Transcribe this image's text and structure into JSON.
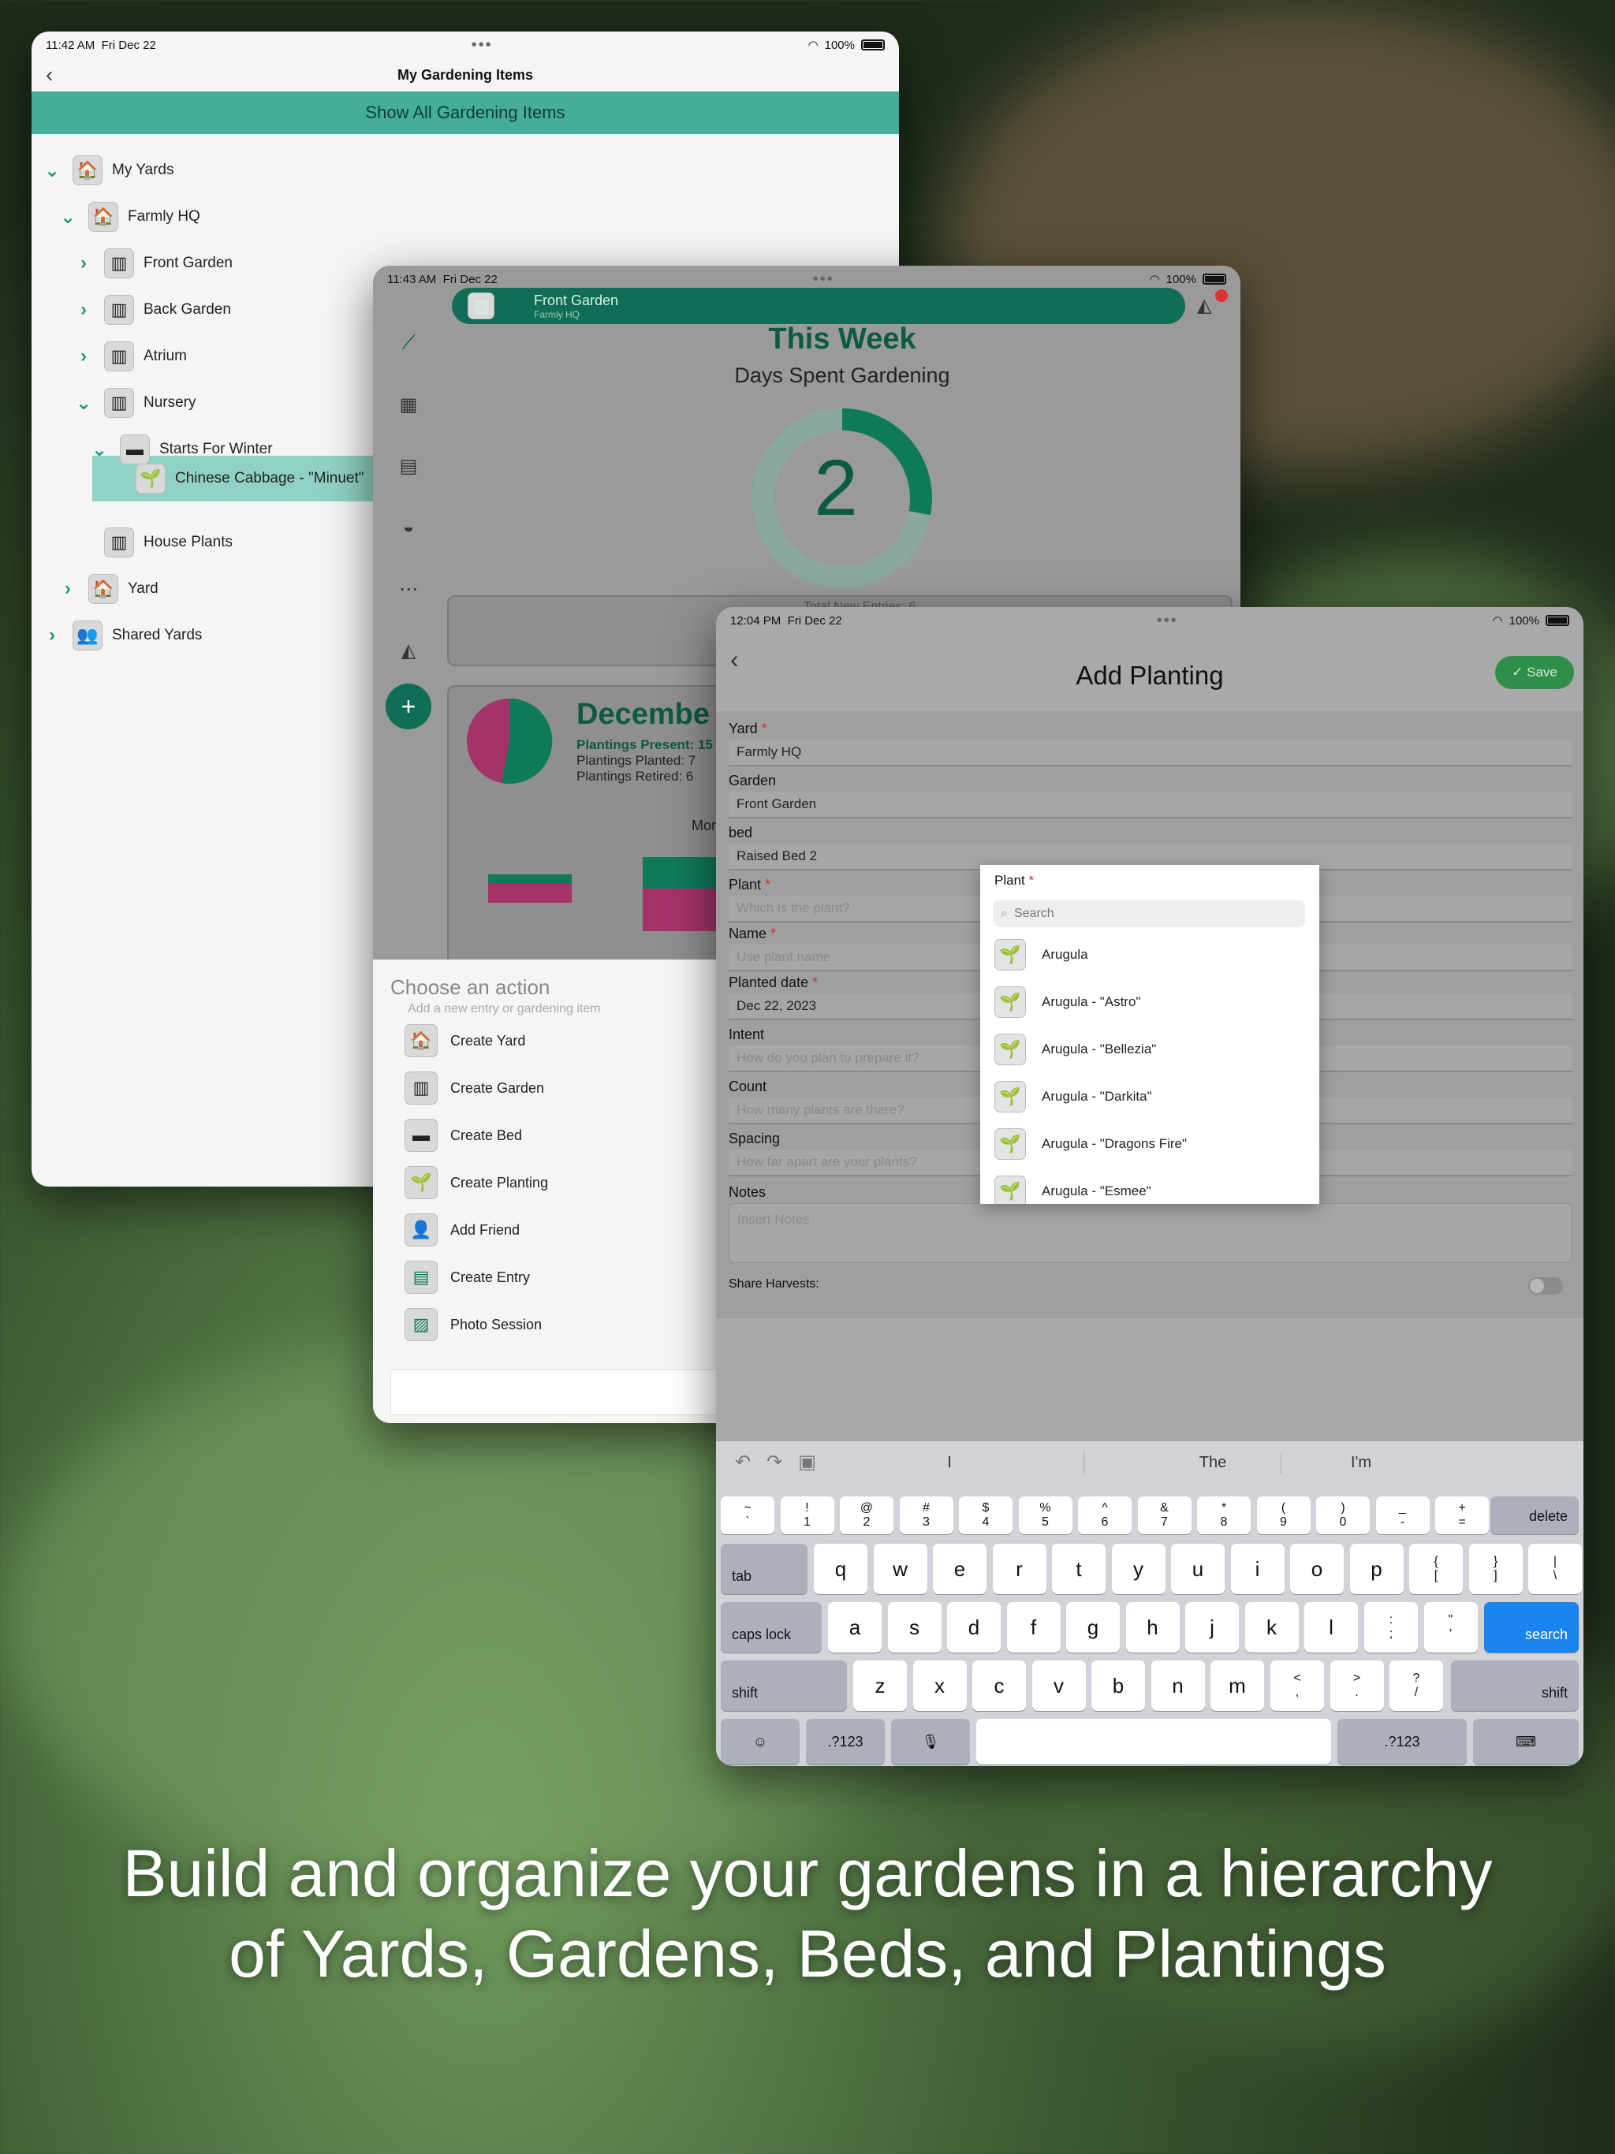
{
  "caption": "Build and organize your gardens in a hierarchy of Yards, Gardens, Beds, and Plantings",
  "tree_window": {
    "status": {
      "time": "11:42 AM",
      "date": "Fri Dec 22",
      "battery": "100%"
    },
    "title": "My Gardening Items",
    "show_all_label": "Show All Gardening Items",
    "items": [
      {
        "label": "My Yards",
        "chevron": "down",
        "icon": "house"
      },
      {
        "label": "Farmly HQ",
        "chevron": "down",
        "icon": "house"
      },
      {
        "label": "Front Garden",
        "chevron": "right",
        "icon": "garden"
      },
      {
        "label": "Back Garden",
        "chevron": "right",
        "icon": "garden"
      },
      {
        "label": "Atrium",
        "chevron": "right",
        "icon": "garden"
      },
      {
        "label": "Nursery",
        "chevron": "down",
        "icon": "garden"
      },
      {
        "label": "Starts For Winter",
        "chevron": "down",
        "icon": "bed"
      },
      {
        "label": "Chinese Cabbage - \"Minuet\"",
        "chevron": "",
        "icon": "planting"
      },
      {
        "label": "House Plants",
        "chevron": "",
        "icon": "garden"
      },
      {
        "label": "Yard",
        "chevron": "right",
        "icon": "house"
      },
      {
        "label": "Shared Yards",
        "chevron": "right",
        "icon": "people"
      }
    ]
  },
  "dashboard_window": {
    "status": {
      "time": "11:43 AM",
      "date": "Fri Dec 22",
      "battery": "100%"
    },
    "garden_name": "Front Garden",
    "garden_yard": "Farmly HQ",
    "this_week": "This Week",
    "days_spent_label": "Days Spent Gardening",
    "days_spent_value": "2",
    "days_spent_fraction": 0.28,
    "month_title": "Decembe",
    "plantings_present": "Plantings Present: 15",
    "plantings_planted": "Plantings Planted: 7",
    "plantings_retired": "Plantings Retired: 6",
    "more_label": "Mor",
    "total_text": "Total New Entries: 6",
    "action_sheet": {
      "title": "Choose an action",
      "subtitle": "Add a new entry or gardening item",
      "actions": [
        {
          "label": "Create Yard",
          "icon": "house"
        },
        {
          "label": "Create Garden",
          "icon": "garden"
        },
        {
          "label": "Create Bed",
          "icon": "bed"
        },
        {
          "label": "Create Planting",
          "icon": "planting"
        },
        {
          "label": "Add Friend",
          "icon": "friend"
        },
        {
          "label": "Create Entry",
          "icon": "entry"
        },
        {
          "label": "Photo Session",
          "icon": "photo"
        }
      ]
    }
  },
  "add_window": {
    "status": {
      "time": "12:04 PM",
      "date": "Fri Dec 22",
      "battery": "100%"
    },
    "save_label": "✓ Save",
    "title": "Add Planting",
    "fields": {
      "yard_label": "Yard",
      "yard_value": "Farmly HQ",
      "garden_label": "Garden",
      "garden_value": "Front Garden",
      "bed_label": "bed",
      "bed_value": "Raised Bed 2",
      "plant_label": "Plant",
      "plant_placeholder": "Which is the plant?",
      "name_label": "Name",
      "name_placeholder": "Use plant name",
      "date_label": "Planted date",
      "date_value": "Dec 22, 2023",
      "intent_label": "Intent",
      "intent_placeholder": "How do you plan to prepare it?",
      "count_label": "Count",
      "count_placeholder": "How many plants are there?",
      "spacing_label": "Spacing",
      "spacing_placeholder": "How far apart are your plants?",
      "notes_label": "Notes",
      "notes_placeholder": "Insert Notes",
      "share_label": "Share Harvests:"
    },
    "picker": {
      "title": "Plant",
      "search_placeholder": "Search",
      "options": [
        "Arugula",
        "Arugula - \"Astro\"",
        "Arugula - \"Bellezia\"",
        "Arugula - \"Darkita\"",
        "Arugula - \"Dragons Fire\"",
        "Arugula - \"Esmee\""
      ]
    },
    "keyboard": {
      "suggestions": [
        "I",
        "The",
        "I'm"
      ],
      "number_row": [
        [
          "~",
          "`"
        ],
        [
          "!",
          "1"
        ],
        [
          "@",
          "2"
        ],
        [
          "#",
          "3"
        ],
        [
          "$",
          "4"
        ],
        [
          "%",
          "5"
        ],
        [
          "^",
          "6"
        ],
        [
          "&",
          "7"
        ],
        [
          "*",
          "8"
        ],
        [
          "(",
          "9"
        ],
        [
          ")",
          "0"
        ],
        [
          "_",
          "-"
        ],
        [
          "+",
          "="
        ]
      ],
      "delete": "delete",
      "tab": "tab",
      "row1": [
        "q",
        "w",
        "e",
        "r",
        "t",
        "y",
        "u",
        "i",
        "o",
        "p"
      ],
      "row1_extra": [
        [
          "{",
          "["
        ],
        [
          "}",
          "]"
        ],
        [
          "|",
          "\\"
        ]
      ],
      "caps": "caps lock",
      "row2": [
        "a",
        "s",
        "d",
        "f",
        "g",
        "h",
        "j",
        "k",
        "l"
      ],
      "row2_extra": [
        [
          ":",
          ";"
        ],
        [
          "\"",
          "'"
        ]
      ],
      "search": "search",
      "shift": "shift",
      "row3": [
        "z",
        "x",
        "c",
        "v",
        "b",
        "n",
        "m"
      ],
      "row3_extra": [
        [
          "<",
          ","
        ],
        [
          ">",
          "."
        ],
        [
          "?",
          "/"
        ]
      ],
      "num_key": ".?123"
    }
  }
}
